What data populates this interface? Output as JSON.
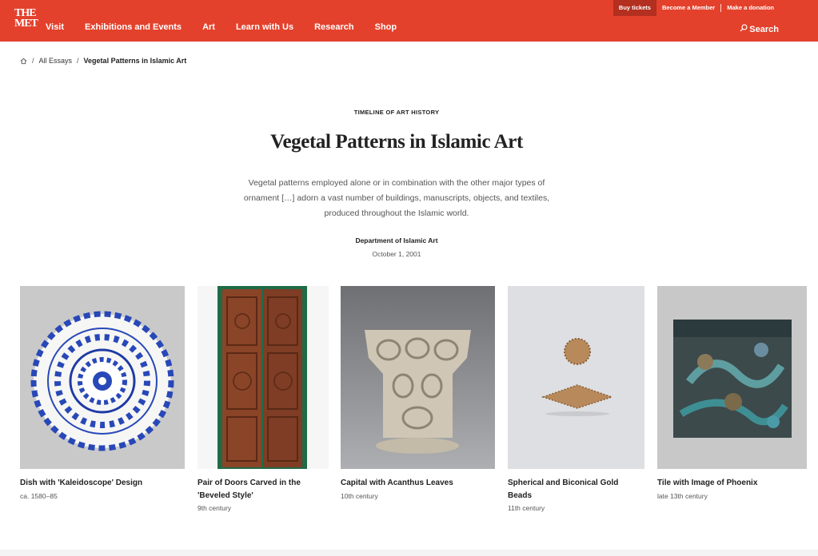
{
  "header": {
    "logo_line1": "THE",
    "logo_line2": "MET",
    "nav": [
      "Visit",
      "Exhibitions and Events",
      "Art",
      "Learn with Us",
      "Research",
      "Shop"
    ],
    "utility": {
      "buy_tickets": "Buy tickets",
      "become_member": "Become a Member",
      "make_donation": "Make a donation"
    },
    "search_label": "Search",
    "accent_color": "#e4412c"
  },
  "breadcrumb": {
    "home_icon": "home-icon",
    "items": [
      "All Essays",
      "Vegetal Patterns in Islamic Art"
    ]
  },
  "essay": {
    "eyebrow": "TIMELINE OF ART HISTORY",
    "title": "Vegetal Patterns in Islamic Art",
    "summary": "Vegetal patterns employed alone or in combination with the other major types of ornament […] adorn a vast number of buildings, manuscripts, objects, and textiles, produced throughout the Islamic world.",
    "department": "Department of Islamic Art",
    "date": "October 1, 2001"
  },
  "artworks": [
    {
      "title": "Dish with 'Kaleidoscope' Design",
      "date": "ca. 1580–85"
    },
    {
      "title": "Pair of Doors Carved in the 'Beveled Style'",
      "date": "9th century"
    },
    {
      "title": "Capital with Acanthus Leaves",
      "date": "10th century"
    },
    {
      "title": "Spherical and Biconical Gold Beads",
      "date": "11th century"
    },
    {
      "title": "Tile with Image of Phoenix",
      "date": "late 13th century"
    }
  ]
}
